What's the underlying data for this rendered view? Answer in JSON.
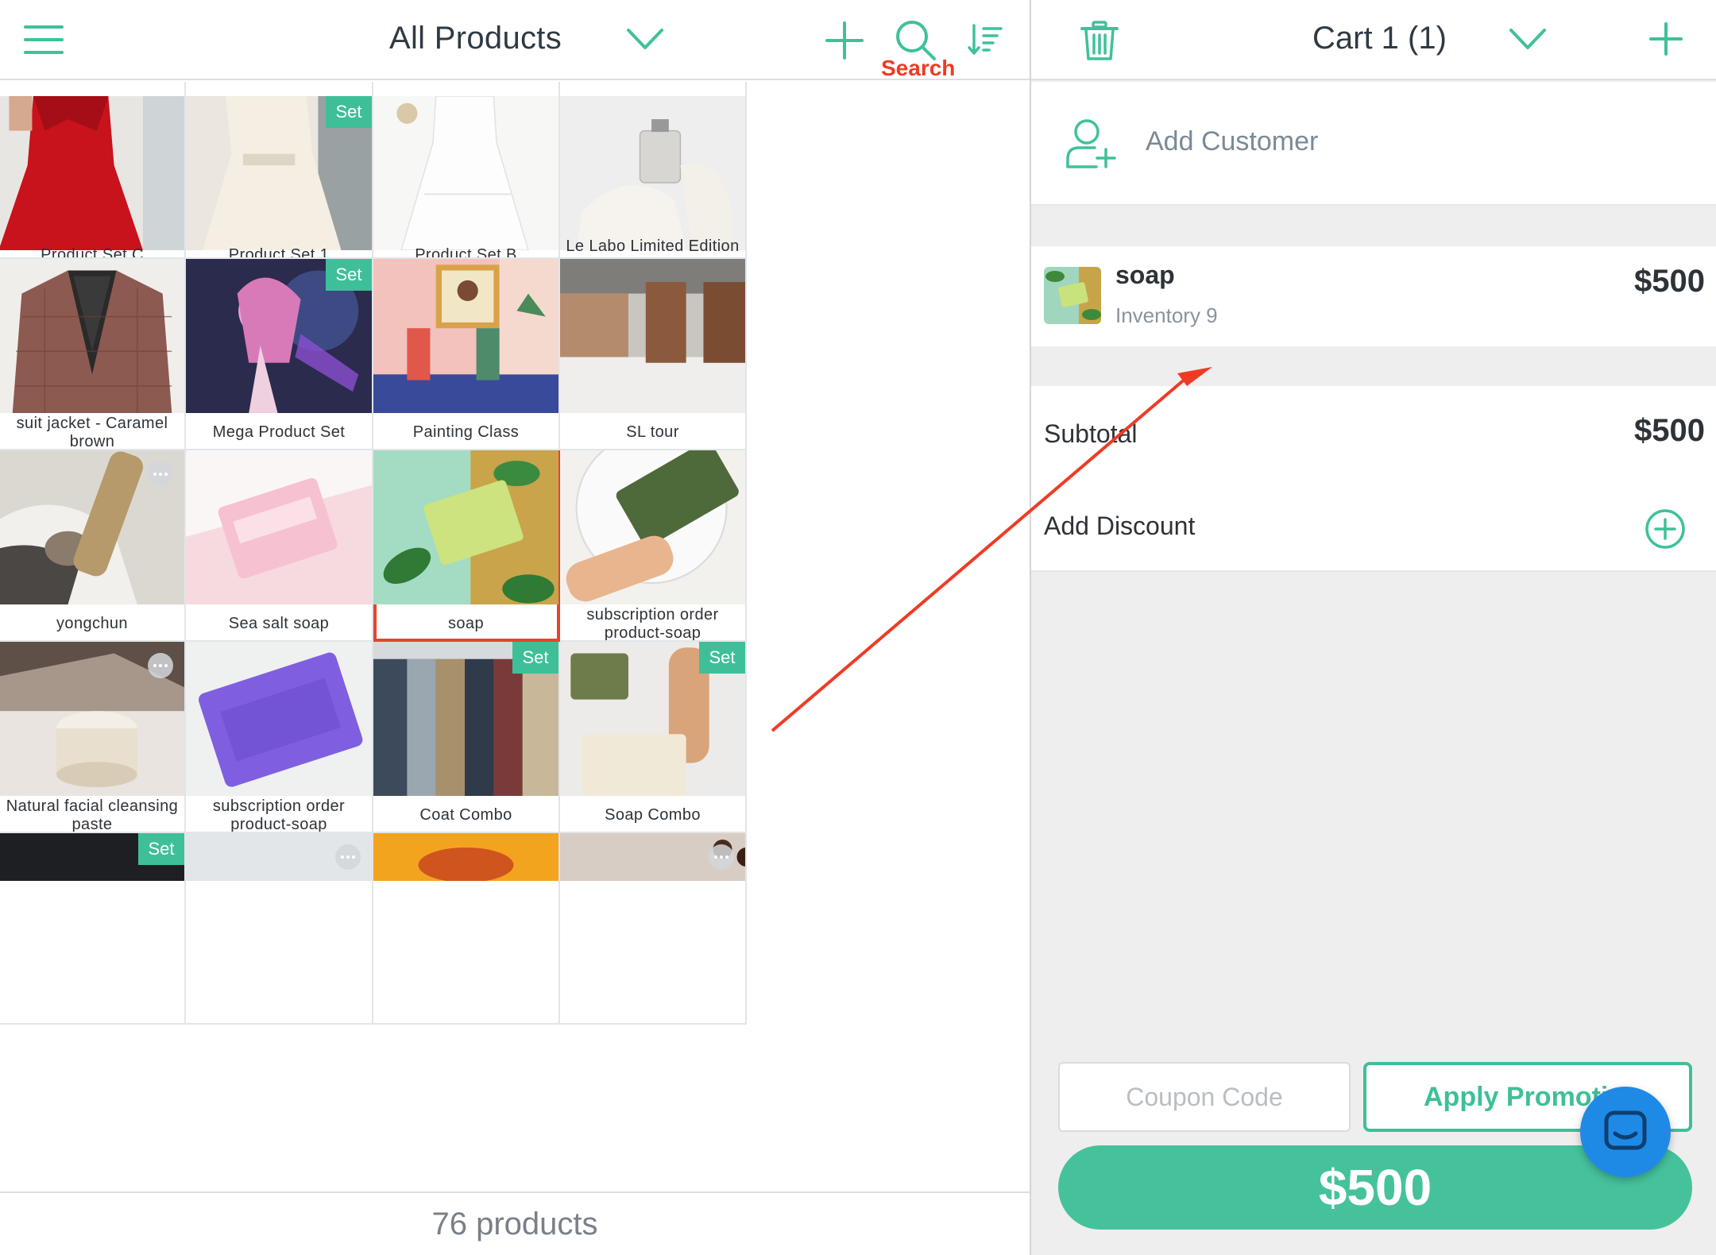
{
  "left_header": {
    "title": "All Products",
    "search_caption": "Search",
    "icons": [
      "menu-icon",
      "chevron-down-icon",
      "plus-icon",
      "search-icon",
      "sort-icon"
    ]
  },
  "products": [
    {
      "name": "Product Set C",
      "badge": "",
      "more": false,
      "art": "red-dress"
    },
    {
      "name": "Product Set 1",
      "badge": "Set",
      "more": false,
      "art": "white-dress"
    },
    {
      "name": "Product Set B",
      "badge": "",
      "more": false,
      "art": "white-gown"
    },
    {
      "name": "Le Labo Limited Edition Scent - Tokyo",
      "badge": "",
      "more": false,
      "art": "perfume"
    },
    {
      "name": "suit jacket - Caramel brown",
      "badge": "",
      "more": false,
      "art": "jacket"
    },
    {
      "name": "Mega Product Set",
      "badge": "Set",
      "more": false,
      "art": "anime"
    },
    {
      "name": "Painting Class",
      "badge": "",
      "more": false,
      "art": "painting"
    },
    {
      "name": "SL tour",
      "badge": "",
      "more": false,
      "art": "hall"
    },
    {
      "name": "yongchun",
      "badge": "",
      "more": true,
      "art": "cat"
    },
    {
      "name": "Sea salt soap",
      "badge": "",
      "more": false,
      "art": "pink-soap"
    },
    {
      "name": "soap",
      "badge": "",
      "more": false,
      "art": "green-soap"
    },
    {
      "name": "subscription order product-soap",
      "badge": "",
      "more": false,
      "art": "olive-soap"
    },
    {
      "name": "Natural facial cleansing paste",
      "badge": "",
      "more": true,
      "art": "jar"
    },
    {
      "name": "subscription order product-soap",
      "badge": "",
      "more": false,
      "art": "purple-soap"
    },
    {
      "name": "Coat Combo",
      "badge": "Set",
      "more": false,
      "art": "coats"
    },
    {
      "name": "Soap Combo",
      "badge": "Set",
      "more": false,
      "art": "soap-combo"
    },
    {
      "name": "",
      "badge": "Set",
      "more": false,
      "art": "dark"
    },
    {
      "name": "",
      "badge": "",
      "more": true,
      "art": "light"
    },
    {
      "name": "",
      "badge": "",
      "more": false,
      "art": "yellow"
    },
    {
      "name": "",
      "badge": "",
      "more": true,
      "art": "coffee"
    }
  ],
  "selected_product": "soap",
  "footer": {
    "count_label": "76 products"
  },
  "cart": {
    "title": "Cart 1 (1)",
    "add_customer": "Add Customer",
    "item": {
      "name": "soap",
      "inventory": "Inventory 9",
      "price": "$500"
    },
    "subtotal_label": "Subtotal",
    "subtotal_value": "$500",
    "discount_label": "Add Discount",
    "coupon_placeholder": "Coupon Code",
    "apply_promo": "Apply Promotion",
    "pay_total": "$500"
  },
  "colors": {
    "accent": "#3fbf99",
    "annotation": "#ef3b24",
    "chat": "#1f8ae6"
  }
}
